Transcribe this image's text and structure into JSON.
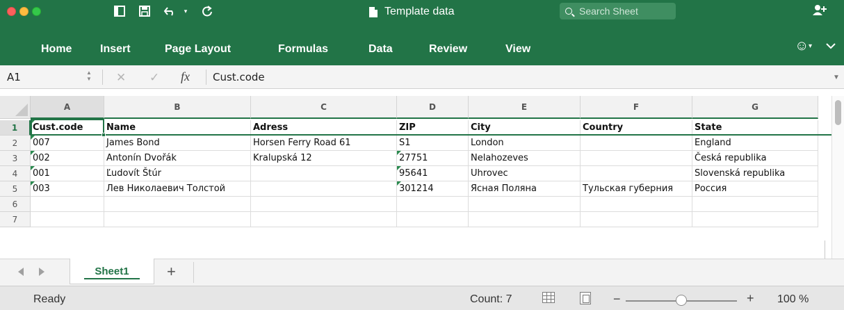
{
  "titlebar": {
    "title": "Template data",
    "search_placeholder": "Search Sheet",
    "search_caret": "⌄",
    "share_icon": "person-plus-icon"
  },
  "ribbon": {
    "tabs": [
      "Home",
      "Insert",
      "Page Layout",
      "Formulas",
      "Data",
      "Review",
      "View"
    ]
  },
  "formula_bar": {
    "name_box": "A1",
    "formula": "Cust.code",
    "fx": "fx"
  },
  "grid": {
    "columns": [
      "A",
      "B",
      "C",
      "D",
      "E",
      "F",
      "G"
    ],
    "rows": [
      "1",
      "2",
      "3",
      "4",
      "5",
      "6",
      "7"
    ],
    "cells": [
      [
        "Cust.code",
        "Name",
        "Adress",
        "ZIP",
        "City",
        "Country",
        "State"
      ],
      [
        "007",
        "James Bond",
        "Horsen Ferry Road 61",
        "S1",
        "London",
        "",
        "England"
      ],
      [
        "002",
        "Antonín Dvořák",
        "Kralupská 12",
        "27751",
        "Nelahozeves",
        "",
        "Česká republika"
      ],
      [
        "001",
        "Ľudovít Štúr",
        "",
        "95641",
        "Uhrovec",
        "",
        "Slovenská republika"
      ],
      [
        "003",
        "Лев Николаевич Толстой",
        "",
        "301214",
        "Ясная Поляна",
        "Тульская губерния",
        "Россия"
      ],
      [
        "",
        "",
        "",
        "",
        "",
        "",
        ""
      ],
      [
        "",
        "",
        "",
        "",
        "",
        "",
        ""
      ]
    ]
  },
  "sheets": {
    "active": "Sheet1",
    "add_label": "+"
  },
  "status": {
    "ready": "Ready",
    "count": "Count: 7",
    "zoom": "100 %",
    "zoom_level": 0.5
  },
  "colors": {
    "accent": "#227447",
    "ribbon": "#227447"
  }
}
